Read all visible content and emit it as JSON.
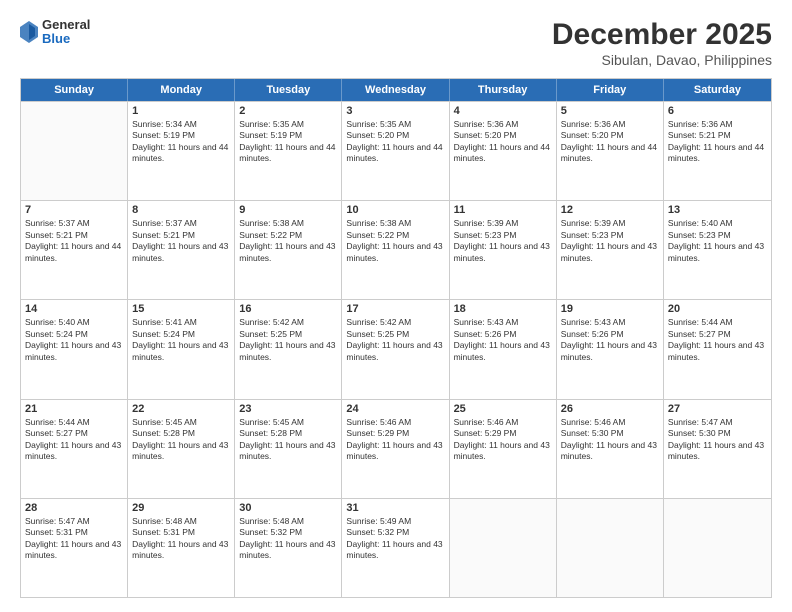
{
  "logo": {
    "general": "General",
    "blue": "Blue"
  },
  "header": {
    "title": "December 2025",
    "subtitle": "Sibulan, Davao, Philippines"
  },
  "weekdays": [
    "Sunday",
    "Monday",
    "Tuesday",
    "Wednesday",
    "Thursday",
    "Friday",
    "Saturday"
  ],
  "weeks": [
    [
      {
        "day": "",
        "empty": true
      },
      {
        "day": "1",
        "sunrise": "Sunrise: 5:34 AM",
        "sunset": "Sunset: 5:19 PM",
        "daylight": "Daylight: 11 hours and 44 minutes."
      },
      {
        "day": "2",
        "sunrise": "Sunrise: 5:35 AM",
        "sunset": "Sunset: 5:19 PM",
        "daylight": "Daylight: 11 hours and 44 minutes."
      },
      {
        "day": "3",
        "sunrise": "Sunrise: 5:35 AM",
        "sunset": "Sunset: 5:20 PM",
        "daylight": "Daylight: 11 hours and 44 minutes."
      },
      {
        "day": "4",
        "sunrise": "Sunrise: 5:36 AM",
        "sunset": "Sunset: 5:20 PM",
        "daylight": "Daylight: 11 hours and 44 minutes."
      },
      {
        "day": "5",
        "sunrise": "Sunrise: 5:36 AM",
        "sunset": "Sunset: 5:20 PM",
        "daylight": "Daylight: 11 hours and 44 minutes."
      },
      {
        "day": "6",
        "sunrise": "Sunrise: 5:36 AM",
        "sunset": "Sunset: 5:21 PM",
        "daylight": "Daylight: 11 hours and 44 minutes."
      }
    ],
    [
      {
        "day": "7",
        "sunrise": "Sunrise: 5:37 AM",
        "sunset": "Sunset: 5:21 PM",
        "daylight": "Daylight: 11 hours and 44 minutes."
      },
      {
        "day": "8",
        "sunrise": "Sunrise: 5:37 AM",
        "sunset": "Sunset: 5:21 PM",
        "daylight": "Daylight: 11 hours and 43 minutes."
      },
      {
        "day": "9",
        "sunrise": "Sunrise: 5:38 AM",
        "sunset": "Sunset: 5:22 PM",
        "daylight": "Daylight: 11 hours and 43 minutes."
      },
      {
        "day": "10",
        "sunrise": "Sunrise: 5:38 AM",
        "sunset": "Sunset: 5:22 PM",
        "daylight": "Daylight: 11 hours and 43 minutes."
      },
      {
        "day": "11",
        "sunrise": "Sunrise: 5:39 AM",
        "sunset": "Sunset: 5:23 PM",
        "daylight": "Daylight: 11 hours and 43 minutes."
      },
      {
        "day": "12",
        "sunrise": "Sunrise: 5:39 AM",
        "sunset": "Sunset: 5:23 PM",
        "daylight": "Daylight: 11 hours and 43 minutes."
      },
      {
        "day": "13",
        "sunrise": "Sunrise: 5:40 AM",
        "sunset": "Sunset: 5:23 PM",
        "daylight": "Daylight: 11 hours and 43 minutes."
      }
    ],
    [
      {
        "day": "14",
        "sunrise": "Sunrise: 5:40 AM",
        "sunset": "Sunset: 5:24 PM",
        "daylight": "Daylight: 11 hours and 43 minutes."
      },
      {
        "day": "15",
        "sunrise": "Sunrise: 5:41 AM",
        "sunset": "Sunset: 5:24 PM",
        "daylight": "Daylight: 11 hours and 43 minutes."
      },
      {
        "day": "16",
        "sunrise": "Sunrise: 5:42 AM",
        "sunset": "Sunset: 5:25 PM",
        "daylight": "Daylight: 11 hours and 43 minutes."
      },
      {
        "day": "17",
        "sunrise": "Sunrise: 5:42 AM",
        "sunset": "Sunset: 5:25 PM",
        "daylight": "Daylight: 11 hours and 43 minutes."
      },
      {
        "day": "18",
        "sunrise": "Sunrise: 5:43 AM",
        "sunset": "Sunset: 5:26 PM",
        "daylight": "Daylight: 11 hours and 43 minutes."
      },
      {
        "day": "19",
        "sunrise": "Sunrise: 5:43 AM",
        "sunset": "Sunset: 5:26 PM",
        "daylight": "Daylight: 11 hours and 43 minutes."
      },
      {
        "day": "20",
        "sunrise": "Sunrise: 5:44 AM",
        "sunset": "Sunset: 5:27 PM",
        "daylight": "Daylight: 11 hours and 43 minutes."
      }
    ],
    [
      {
        "day": "21",
        "sunrise": "Sunrise: 5:44 AM",
        "sunset": "Sunset: 5:27 PM",
        "daylight": "Daylight: 11 hours and 43 minutes."
      },
      {
        "day": "22",
        "sunrise": "Sunrise: 5:45 AM",
        "sunset": "Sunset: 5:28 PM",
        "daylight": "Daylight: 11 hours and 43 minutes."
      },
      {
        "day": "23",
        "sunrise": "Sunrise: 5:45 AM",
        "sunset": "Sunset: 5:28 PM",
        "daylight": "Daylight: 11 hours and 43 minutes."
      },
      {
        "day": "24",
        "sunrise": "Sunrise: 5:46 AM",
        "sunset": "Sunset: 5:29 PM",
        "daylight": "Daylight: 11 hours and 43 minutes."
      },
      {
        "day": "25",
        "sunrise": "Sunrise: 5:46 AM",
        "sunset": "Sunset: 5:29 PM",
        "daylight": "Daylight: 11 hours and 43 minutes."
      },
      {
        "day": "26",
        "sunrise": "Sunrise: 5:46 AM",
        "sunset": "Sunset: 5:30 PM",
        "daylight": "Daylight: 11 hours and 43 minutes."
      },
      {
        "day": "27",
        "sunrise": "Sunrise: 5:47 AM",
        "sunset": "Sunset: 5:30 PM",
        "daylight": "Daylight: 11 hours and 43 minutes."
      }
    ],
    [
      {
        "day": "28",
        "sunrise": "Sunrise: 5:47 AM",
        "sunset": "Sunset: 5:31 PM",
        "daylight": "Daylight: 11 hours and 43 minutes."
      },
      {
        "day": "29",
        "sunrise": "Sunrise: 5:48 AM",
        "sunset": "Sunset: 5:31 PM",
        "daylight": "Daylight: 11 hours and 43 minutes."
      },
      {
        "day": "30",
        "sunrise": "Sunrise: 5:48 AM",
        "sunset": "Sunset: 5:32 PM",
        "daylight": "Daylight: 11 hours and 43 minutes."
      },
      {
        "day": "31",
        "sunrise": "Sunrise: 5:49 AM",
        "sunset": "Sunset: 5:32 PM",
        "daylight": "Daylight: 11 hours and 43 minutes."
      },
      {
        "day": "",
        "empty": true
      },
      {
        "day": "",
        "empty": true
      },
      {
        "day": "",
        "empty": true
      }
    ]
  ]
}
